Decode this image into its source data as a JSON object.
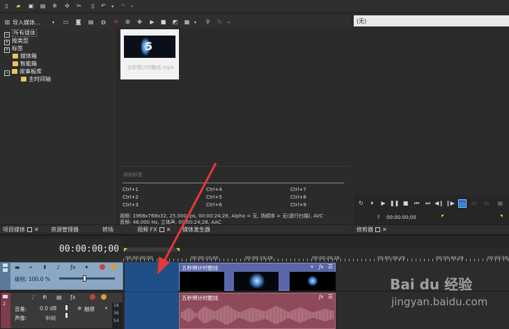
{
  "toolbar_top": {
    "icons": [
      "new-icon",
      "open-icon",
      "save-icon",
      "save-as-icon",
      "gear-icon",
      "settings-icon",
      "render-icon",
      "split-icon",
      "paste-icon",
      "undo-icon",
      "undo-dropdown-icon",
      "redo-icon",
      "redo-dropdown-icon"
    ]
  },
  "media_toolbar": {
    "import_label": "导入媒体...",
    "icons": [
      "import-icon",
      "capture-icon",
      "get-media-icon",
      "remove-icon",
      "web-icon",
      "delete-icon",
      "properties-icon",
      "play-icon",
      "stop-icon",
      "auto-preview-icon",
      "zoom-icon",
      "undo-icon"
    ]
  },
  "tree": {
    "items": [
      {
        "label": "所有媒体",
        "selected": true
      },
      {
        "label": "按类型"
      },
      {
        "label": "标签"
      },
      {
        "label": "媒体箱"
      },
      {
        "label": "智能箱"
      },
      {
        "label": "故事板库"
      },
      {
        "label": "主时间轴"
      }
    ]
  },
  "media_item": {
    "name": "五秒倒计时酷炫.mp4"
  },
  "tags": {
    "placeholder": "添加标签",
    "shortcuts": [
      [
        "Ctrl+1",
        "Ctrl+4",
        "Ctrl+7"
      ],
      [
        "Ctrl+2",
        "Ctrl+5",
        "Ctrl+8"
      ],
      [
        "Ctrl+3",
        "Ctrl+6",
        "Ctrl+9"
      ]
    ]
  },
  "media_info": {
    "video": "视频: 1968x768x32, 25.000 fps, 00:00:24;28, Alpha = 无, 场顺序 = 无(逐行扫描), AVC",
    "audio": "音频: 48,000 Hz, 立体声, 00:00:24;28, AAC"
  },
  "tabs_left": [
    {
      "label": "项目媒体"
    },
    {
      "label": "资源管理器"
    },
    {
      "label": "转场"
    },
    {
      "label": "视频 FX"
    },
    {
      "label": "媒体发生器"
    }
  ],
  "preview": {
    "title": "(无)",
    "timecode": "00:00:00;00",
    "tab_label": "修剪器"
  },
  "timeline": {
    "timecode": "00:00:00;00",
    "ruler": [
      "00:00:00;00",
      "00:00:10;00",
      "00:00:19;29",
      "00:00:29;29",
      "00:00:39;29",
      "00:00:49;29",
      "00:00:59;28"
    ],
    "video_track": {
      "level_label": "级别: 100.0 %",
      "clip_name": "五秒倒计时酷炫"
    },
    "audio_track": {
      "volume_label": "音量:",
      "volume_value": "0.0 dB",
      "pan_label": "声像:",
      "pan_value": "中间",
      "mode_label": "触摸",
      "clip_name": "五秒倒计时酷炫",
      "meter_ticks": [
        "18",
        "36",
        "54"
      ]
    }
  },
  "watermark": {
    "brand": "Bai du 经验",
    "url": "jingyan.baidu.com"
  },
  "colors": {
    "video_clip": "#5a66a8",
    "audio_clip": "#8e4a5a",
    "selection": "#1f4f86",
    "arrow": "#e53935"
  }
}
